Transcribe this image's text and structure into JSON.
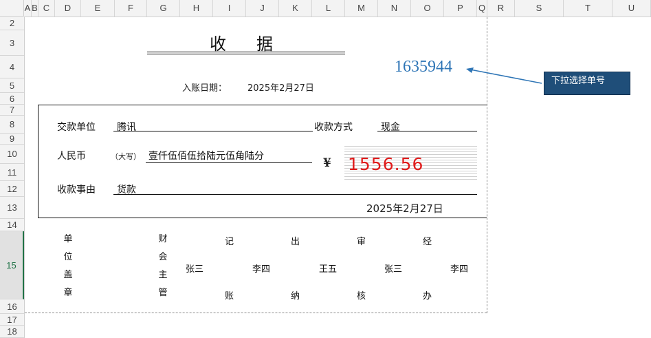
{
  "columns": [
    "A",
    "B",
    "C",
    "D",
    "E",
    "F",
    "G",
    "H",
    "I",
    "J",
    "K",
    "L",
    "M",
    "N",
    "O",
    "P",
    "Q",
    "R",
    "S",
    "T",
    "U"
  ],
  "rows": [
    "2",
    "3",
    "4",
    "5",
    "6",
    "7",
    "8",
    "9",
    "10",
    "11",
    "12",
    "13",
    "14",
    "15",
    "16",
    "17",
    "18"
  ],
  "receipt": {
    "title": "收据",
    "number": "1635944",
    "dropdown_tip": "下拉选择单号",
    "entry_date_label": "入账日期：",
    "entry_date_value": "2025年2月27日",
    "payer_label": "交款单位",
    "payer_value": "腾讯",
    "pay_method_label": "收款方式",
    "pay_method_value": "现金",
    "rmb_label": "人民币",
    "rmb_note": "（大写）",
    "amount_words": "壹仟伍佰伍拾陆元伍角陆分",
    "yuan_symbol": "¥",
    "amount_figure": "1556.56",
    "reason_label": "收款事由",
    "reason_value": "货款",
    "sign_date": "2025年2月27日"
  },
  "signatures": {
    "unit_seal": [
      "单",
      "位",
      "盖",
      "章"
    ],
    "finance_head": [
      "财",
      "会",
      "主",
      "管"
    ],
    "accounting_top": "记",
    "accounting_bottom": "账",
    "accounting_name": "张三",
    "cashier_top": "出",
    "cashier_bottom": "纳",
    "cashier_name": "李四",
    "auditor_top": "审",
    "auditor_bottom": "核",
    "auditor_name": "王五",
    "handler_top": "经",
    "handler_bottom": "办",
    "handler_name": "张三",
    "last_name": "李四"
  },
  "colors": {
    "receipt_number": "#2e75b6",
    "amount_figure": "#e01b1b",
    "tip_background": "#1f4e79",
    "selected_row": "#217346"
  }
}
